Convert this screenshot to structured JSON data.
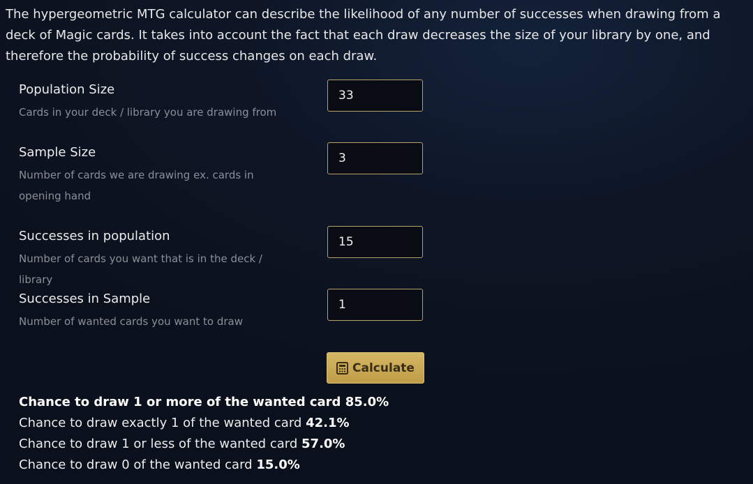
{
  "intro": "The hypergeometric MTG calculator can describe the likelihood of any number of successes when drawing from a deck of Magic cards. It takes into account the fact that each draw decreases the size of your library by one, and therefore the probability of success changes on each draw.",
  "fields": [
    {
      "label": "Population Size",
      "help": "Cards in your deck / library you are drawing from",
      "value": "33"
    },
    {
      "label": "Sample Size",
      "help": "Number of cards we are drawing ex. cards in opening hand",
      "value": "3"
    },
    {
      "label": "Successes in population",
      "help": "Number of cards you want that is in the deck / library",
      "value": "15"
    },
    {
      "label": "Successes in Sample",
      "help": "Number of wanted cards you want to draw",
      "value": "1"
    }
  ],
  "calculate_button": {
    "label": "Calculate",
    "icon": "calculator-icon"
  },
  "results": [
    {
      "text": "Chance to draw 1 or more of the wanted card",
      "value": "85.0%"
    },
    {
      "text": "Chance to draw exactly 1 of the wanted card",
      "value": "42.1%"
    },
    {
      "text": "Chance to draw 1 or less of the wanted card",
      "value": "57.0%"
    },
    {
      "text": "Chance to draw 0 of the wanted card",
      "value": "15.0%"
    }
  ],
  "colors": {
    "accent": "#c9a954",
    "input_border": "#b9a268",
    "help_text": "#8a8f99"
  }
}
